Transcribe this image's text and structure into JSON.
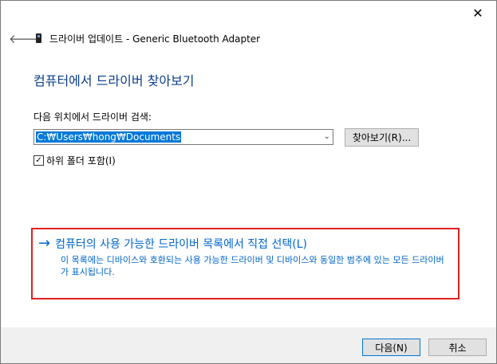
{
  "window": {
    "close_label": "✕"
  },
  "header": {
    "back_icon": "back-arrow-icon",
    "device_icon": "bluetooth-device-icon",
    "title": "드라이버 업데이트 - Generic Bluetooth Adapter"
  },
  "main": {
    "page_title": "컴퓨터에서 드라이버 찾아보기",
    "location_label": "다음 위치에서 드라이버 검색:",
    "path_value": "C:₩Users₩hong₩Documents",
    "browse_label": "찾아보기(R)...",
    "include_subfolders_label": "하위 폴더 포함(I)",
    "include_subfolders_checked": true
  },
  "pick_from_list": {
    "arrow_icon": "right-arrow-icon",
    "title": "컴퓨터의 사용 가능한 드라이버 목록에서 직접 선택(L)",
    "description": "이 목록에는 디바이스와 호환되는 사용 가능한 드라이버 및 디바이스와 동일한 범주에 있는 모든 드라이버가 표시됩니다.",
    "highlight_color": "#e02020",
    "link_color": "#0066cc"
  },
  "footer": {
    "next_label": "다음(N)",
    "cancel_label": "취소"
  },
  "colors": {
    "accent": "#0078d7",
    "title_color": "#0a3e8c"
  }
}
